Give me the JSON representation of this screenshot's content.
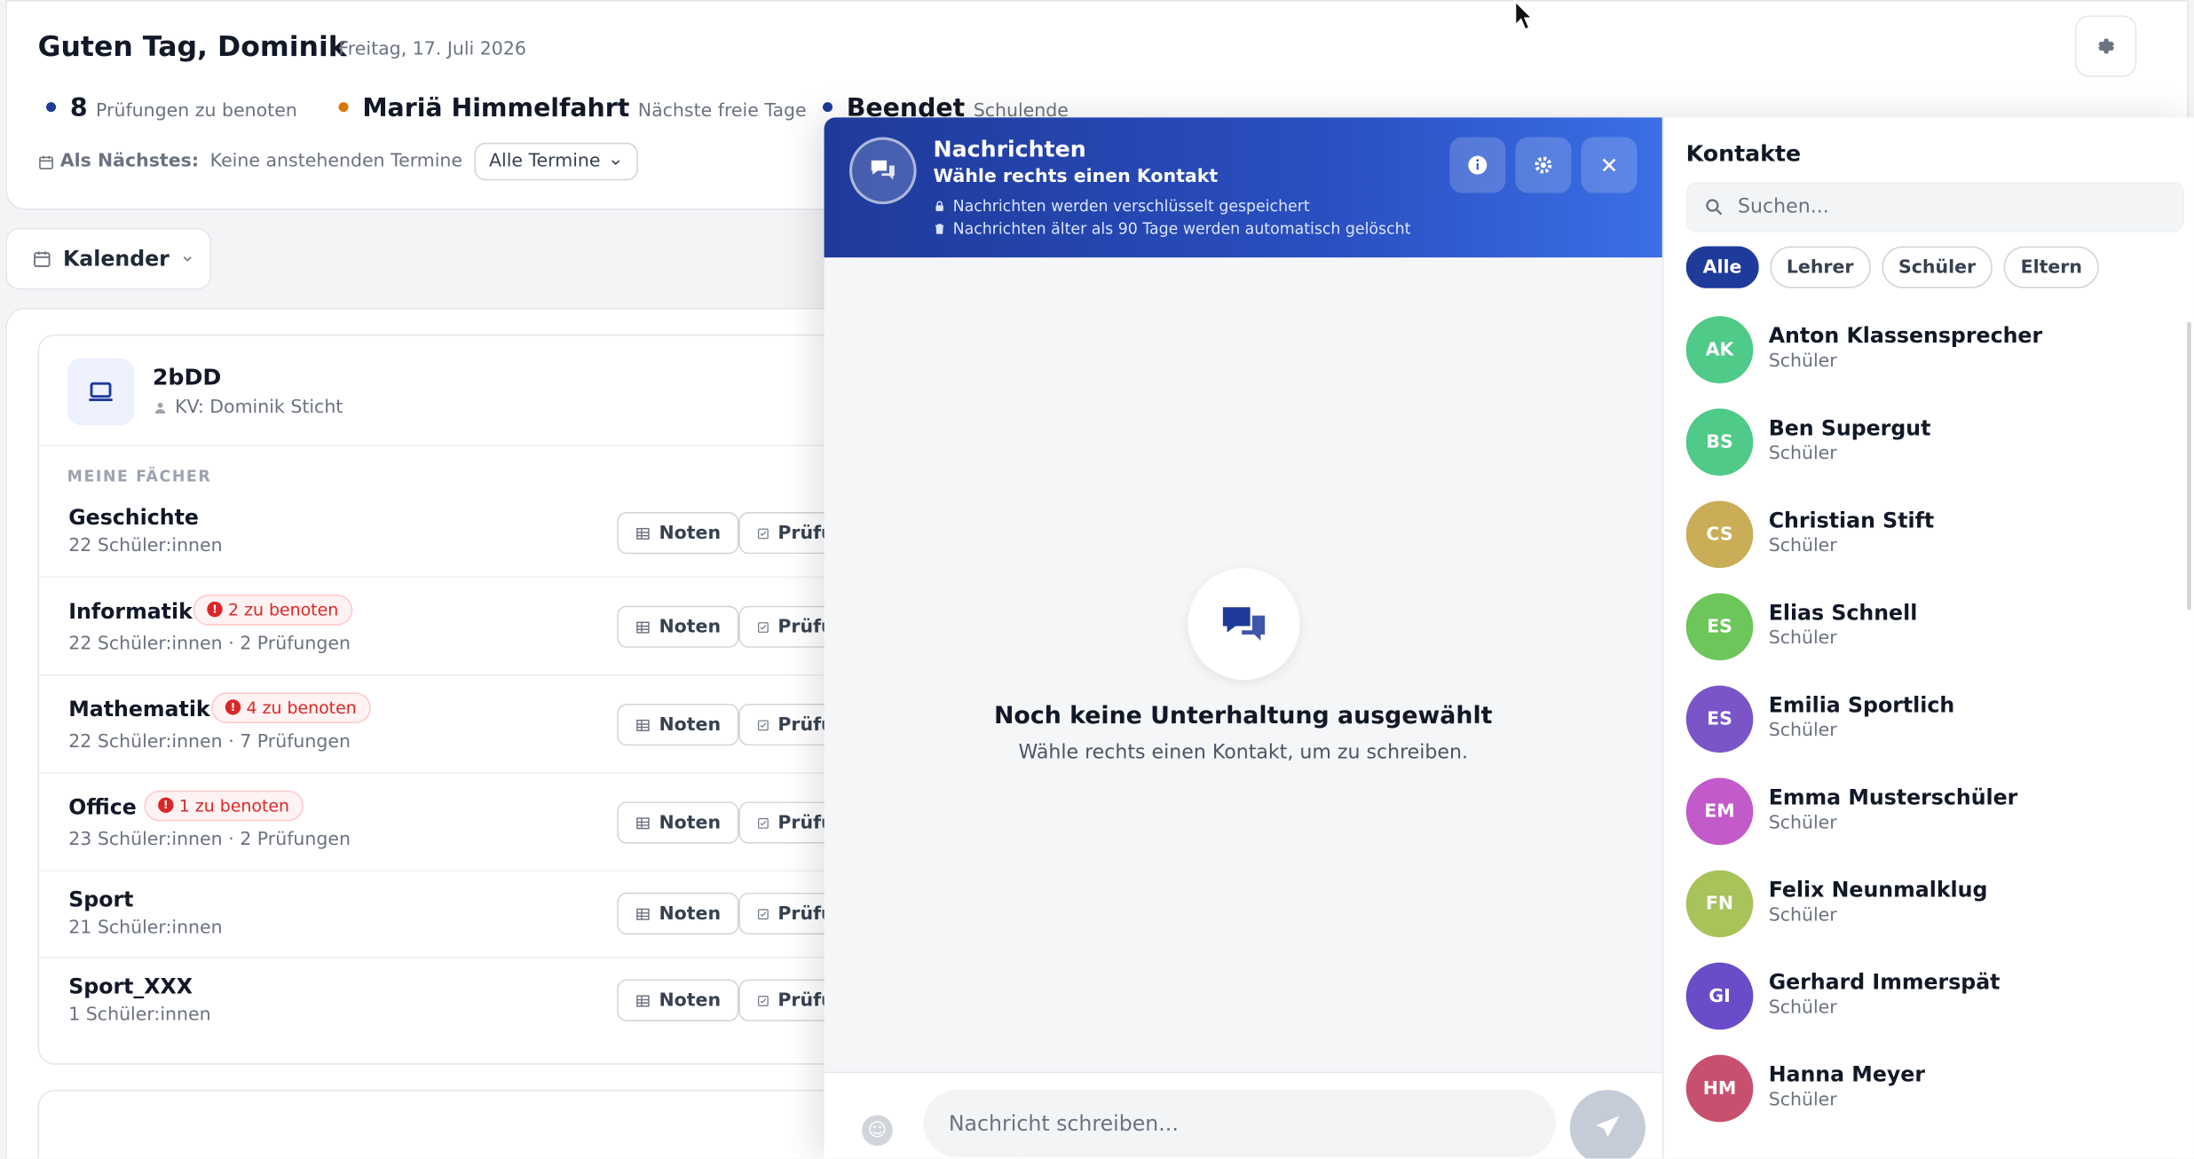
{
  "header": {
    "greeting": "Guten Tag, Dominik",
    "date": "Freitag, 17. Juli 2026",
    "stats": [
      {
        "value": "8",
        "label": "Prüfungen zu benoten",
        "color": "#1e3a9a"
      },
      {
        "value": "Mariä Himmelfahrt",
        "label": "Nächste freie Tage",
        "color": "#d97706"
      },
      {
        "value": "Beendet",
        "label": "Schulende",
        "color": "#1e3a9a"
      }
    ],
    "next_label": "Als Nächstes:",
    "next_value": "Keine anstehenden Termine",
    "termine_select": "Alle Termine"
  },
  "view_select": "Kalender",
  "class": {
    "name": "2bDD",
    "kv": "KV: Dominik Sticht",
    "section_label": "MEINE FÄCHER",
    "subjects": [
      {
        "name": "Geschichte",
        "students": "22 Schüler:innen",
        "exams": "",
        "badge": ""
      },
      {
        "name": "Informatik",
        "students": "22 Schüler:innen",
        "exams": "2 Prüfungen",
        "badge": "2 zu benoten"
      },
      {
        "name": "Mathematik",
        "students": "22 Schüler:innen",
        "exams": "7 Prüfungen",
        "badge": "4 zu benoten"
      },
      {
        "name": "Office",
        "students": "23 Schüler:innen",
        "exams": "2 Prüfungen",
        "badge": "1 zu benoten"
      },
      {
        "name": "Sport",
        "students": "21 Schüler:innen",
        "exams": "",
        "badge": ""
      },
      {
        "name": "Sport_XXX",
        "students": "1 Schüler:innen",
        "exams": "",
        "badge": ""
      }
    ],
    "btn_noten": "Noten",
    "btn_pruefungen": "Prüfu",
    "meta_separator": "·"
  },
  "chat": {
    "title": "Nachrichten",
    "subtitle": "Wähle rechts einen Kontakt",
    "note_encrypted": "Nachrichten werden verschlüsselt gespeichert",
    "note_delete": "Nachrichten älter als 90 Tage werden automatisch gelöscht",
    "empty_title": "Noch keine Unterhaltung ausgewählt",
    "empty_sub": "Wähle rechts einen Kontakt, um zu schreiben.",
    "input_placeholder": "Nachricht schreiben..."
  },
  "contacts": {
    "title": "Kontakte",
    "search_placeholder": "Suchen...",
    "filters": [
      "Alle",
      "Lehrer",
      "Schüler",
      "Eltern"
    ],
    "active_filter": "Alle",
    "list": [
      {
        "initials": "AK",
        "name": "Anton Klassensprecher",
        "role": "Schüler",
        "color": "#4fca88"
      },
      {
        "initials": "BS",
        "name": "Ben Supergut",
        "role": "Schüler",
        "color": "#4fca88"
      },
      {
        "initials": "CS",
        "name": "Christian Stift",
        "role": "Schüler",
        "color": "#c9ad57"
      },
      {
        "initials": "ES",
        "name": "Elias Schnell",
        "role": "Schüler",
        "color": "#6cc659"
      },
      {
        "initials": "ES",
        "name": "Emilia Sportlich",
        "role": "Schüler",
        "color": "#7a55c8"
      },
      {
        "initials": "EM",
        "name": "Emma Musterschüler",
        "role": "Schüler",
        "color": "#c25bc9"
      },
      {
        "initials": "FN",
        "name": "Felix Neunmalklug",
        "role": "Schüler",
        "color": "#a8c35a"
      },
      {
        "initials": "GI",
        "name": "Gerhard Immerspät",
        "role": "Schüler",
        "color": "#6a4cc8"
      },
      {
        "initials": "HM",
        "name": "Hanna Meyer",
        "role": "Schüler",
        "color": "#c8506e"
      }
    ]
  }
}
